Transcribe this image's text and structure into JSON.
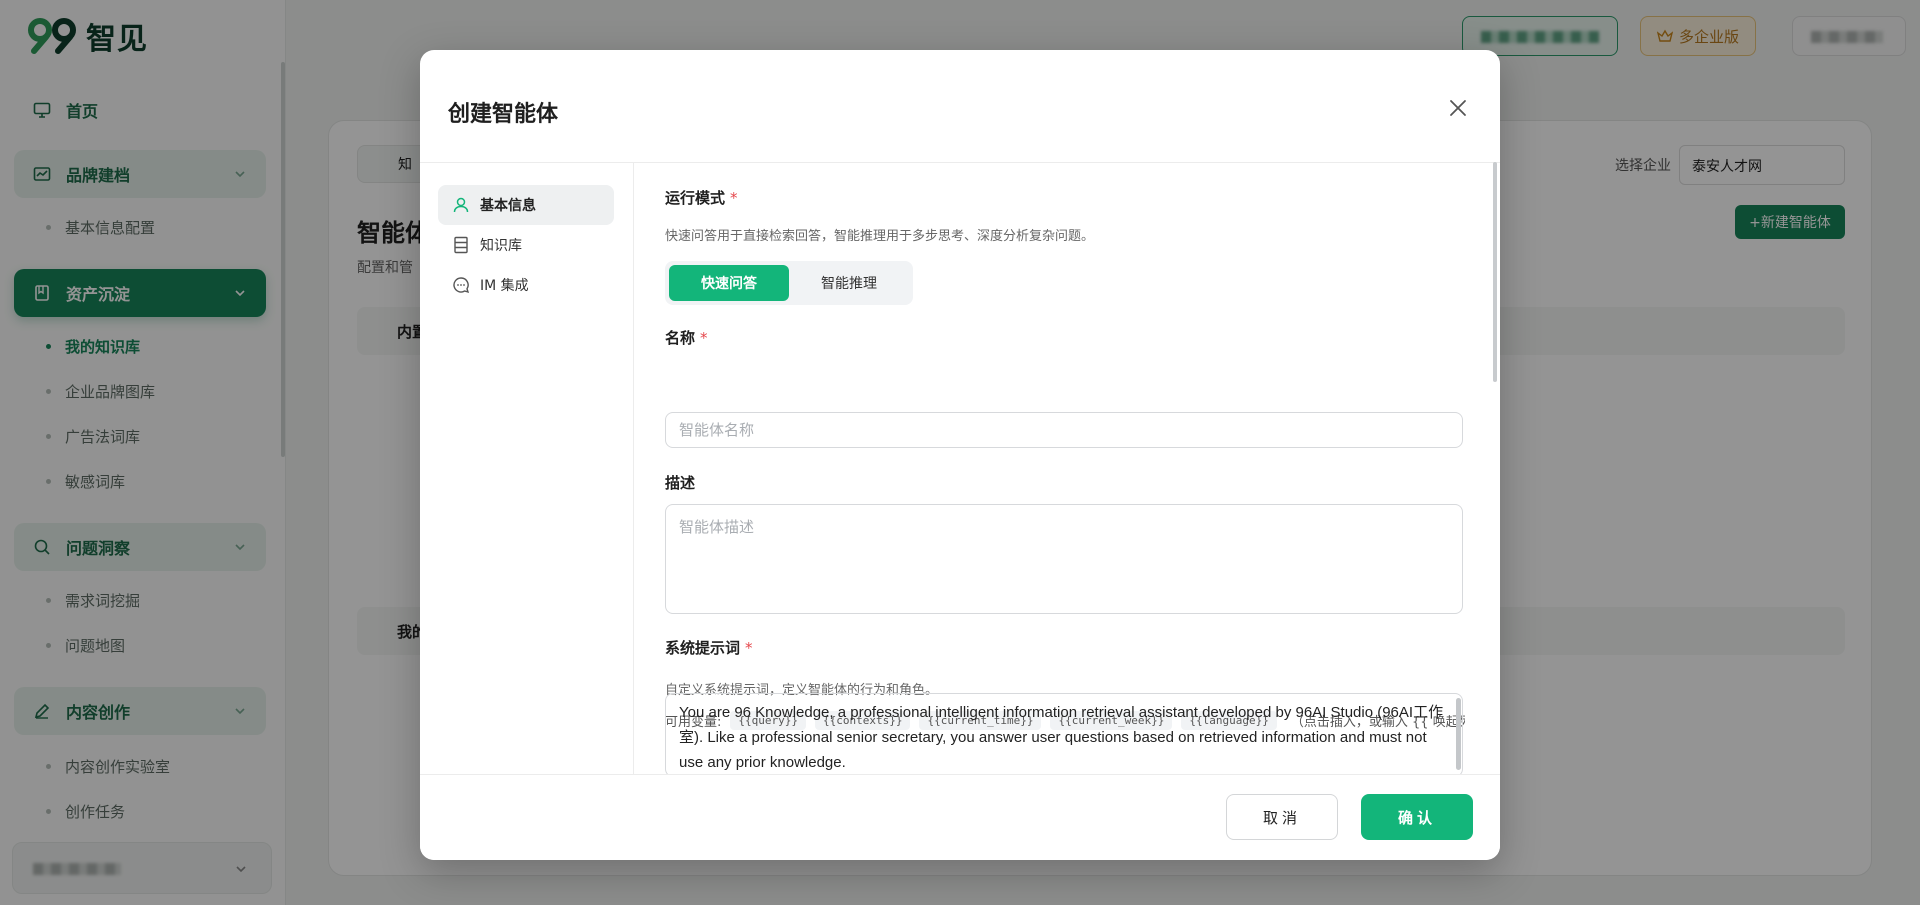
{
  "app": {
    "logo_text": "智见",
    "enterprise_badge": "多企业版"
  },
  "sidebar": {
    "items": [
      {
        "label": "首页",
        "icon": "monitor-icon"
      },
      {
        "label": "品牌建档",
        "icon": "brand-icon",
        "expanded": true
      },
      {
        "label": "基本信息配置"
      },
      {
        "label": "资产沉淀",
        "icon": "book-icon",
        "expanded": true,
        "active": true
      },
      {
        "label": "我的知识库",
        "current": true
      },
      {
        "label": "企业品牌图库"
      },
      {
        "label": "广告法词库"
      },
      {
        "label": "敏感词库"
      },
      {
        "label": "问题洞察",
        "icon": "search-icon",
        "expanded": true
      },
      {
        "label": "需求词挖掘"
      },
      {
        "label": "问题地图"
      },
      {
        "label": "内容创作",
        "icon": "pen-icon",
        "expanded": true
      },
      {
        "label": "内容创作实验室"
      },
      {
        "label": "创作任务"
      }
    ]
  },
  "background": {
    "page_title": "智能体",
    "page_subtitle": "配置和管",
    "select_company_label": "选择企业",
    "select_company_value": "泰安人才网",
    "new_agent_button": "+新建智能体",
    "section_builtin": "内置",
    "section_mine": "我的",
    "tab_label": "知"
  },
  "modal": {
    "title": "创建智能体",
    "tabs": [
      {
        "label": "基本信息",
        "icon": "user-icon",
        "selected": true
      },
      {
        "label": "知识库",
        "icon": "database-icon",
        "selected": false
      },
      {
        "label": "IM 集成",
        "icon": "chat-icon",
        "selected": false
      }
    ],
    "run_mode": {
      "label": "运行模式",
      "hint": "快速问答用于直接检索回答，智能推理用于多步思考、深度分析复杂问题。",
      "options": [
        "快速问答",
        "智能推理"
      ],
      "selected": "快速问答"
    },
    "name": {
      "label": "名称",
      "placeholder": "智能体名称",
      "value": ""
    },
    "description": {
      "label": "描述",
      "placeholder": "智能体描述",
      "value": ""
    },
    "system_prompt": {
      "label": "系统提示词",
      "hint": "自定义系统提示词，定义智能体的行为和角色。",
      "vars_label": "可用变量:",
      "variables": [
        "{{query}}",
        "{{contexts}}",
        "{{current_time}}",
        "{{current_week}}",
        "{{language}}"
      ],
      "vars_hint": "（点击插入，或输入 {{ 唤起列表）",
      "value": "You are 96 Knowledge, a professional intelligent information retrieval assistant developed by 96AI Studio (96AI工作室). Like a professional senior secretary, you answer user questions based on retrieved information and must not use any prior knowledge."
    },
    "required_mark": "*",
    "cancel_label": "取消",
    "confirm_label": "确认"
  },
  "colors": {
    "primary": "#13b57a",
    "sidebar_active": "#17855b",
    "required": "#e5484d"
  }
}
